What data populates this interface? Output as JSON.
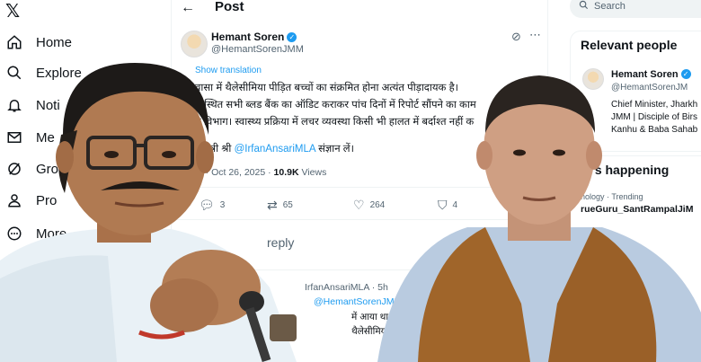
{
  "nav": {
    "items": [
      {
        "label": "Home",
        "icon": "home-icon"
      },
      {
        "label": "Explore",
        "icon": "search-icon"
      },
      {
        "label": "Noti",
        "icon": "bell-icon"
      },
      {
        "label": "Me",
        "icon": "mail-icon"
      },
      {
        "label": "Gro",
        "icon": "slash-circle-icon"
      },
      {
        "label": "Pro",
        "icon": "person-icon"
      },
      {
        "label": "More",
        "icon": "more-circle-icon"
      }
    ]
  },
  "post": {
    "header_title": "Post",
    "author_name": "Hemant Soren",
    "author_handle": "@HemantSorenJMM",
    "show_translation": "Show translation",
    "lines": [
      "वासा में थैलेसीमिया पीड़ित बच्चों का संक्रमित होना अत्यंत पीड़ादायक है।",
      "में स्थित सभी ब्लड बैंक का ऑडिट कराकर पांच दिनों में रिपोर्ट सौंपने का काम",
      "य विभाग। स्वास्थ्य प्रक्रिया में लचर व्यवस्था किसी भी हालत में बर्दाश्त नहीं क"
    ],
    "mention_prefix": "य मंत्री श्री ",
    "mention": "@IrfanAnsariMLA",
    "mention_suffix": " संज्ञान लें।",
    "meta_time": "M · Oct 26, 2025 · ",
    "views_count": "10.9K",
    "views_label": " Views",
    "stats": {
      "comments": "3",
      "reposts": "65",
      "likes": "264",
      "bookmarks": "4"
    },
    "reply_prompt": "reply",
    "reply": {
      "handle_line": "IrfanAnsariMLA · 5h",
      "to_line": "@HemantSorenJMM",
      "text1": "में आया था, जिसके",
      "text2": "थैलेसीमिया पी"
    }
  },
  "right": {
    "search_placeholder": "Search",
    "relevant_title": "Relevant people",
    "person_name": "Hemant Soren",
    "person_handle": "@HemantSorenJM",
    "bio_lines": [
      "Chief Minister, Jharkh",
      "JMM | Disciple of Birs",
      "Kanhu & Baba Sahab"
    ],
    "happening_title": "at’s happening",
    "trend_meta": "nology · Trending",
    "trend_name": "rueGuru_SantRampalJiM"
  },
  "colors": {
    "accent": "#1d9bf0",
    "text": "#0f1419",
    "muted": "#536471",
    "vest": "#a0652a"
  }
}
